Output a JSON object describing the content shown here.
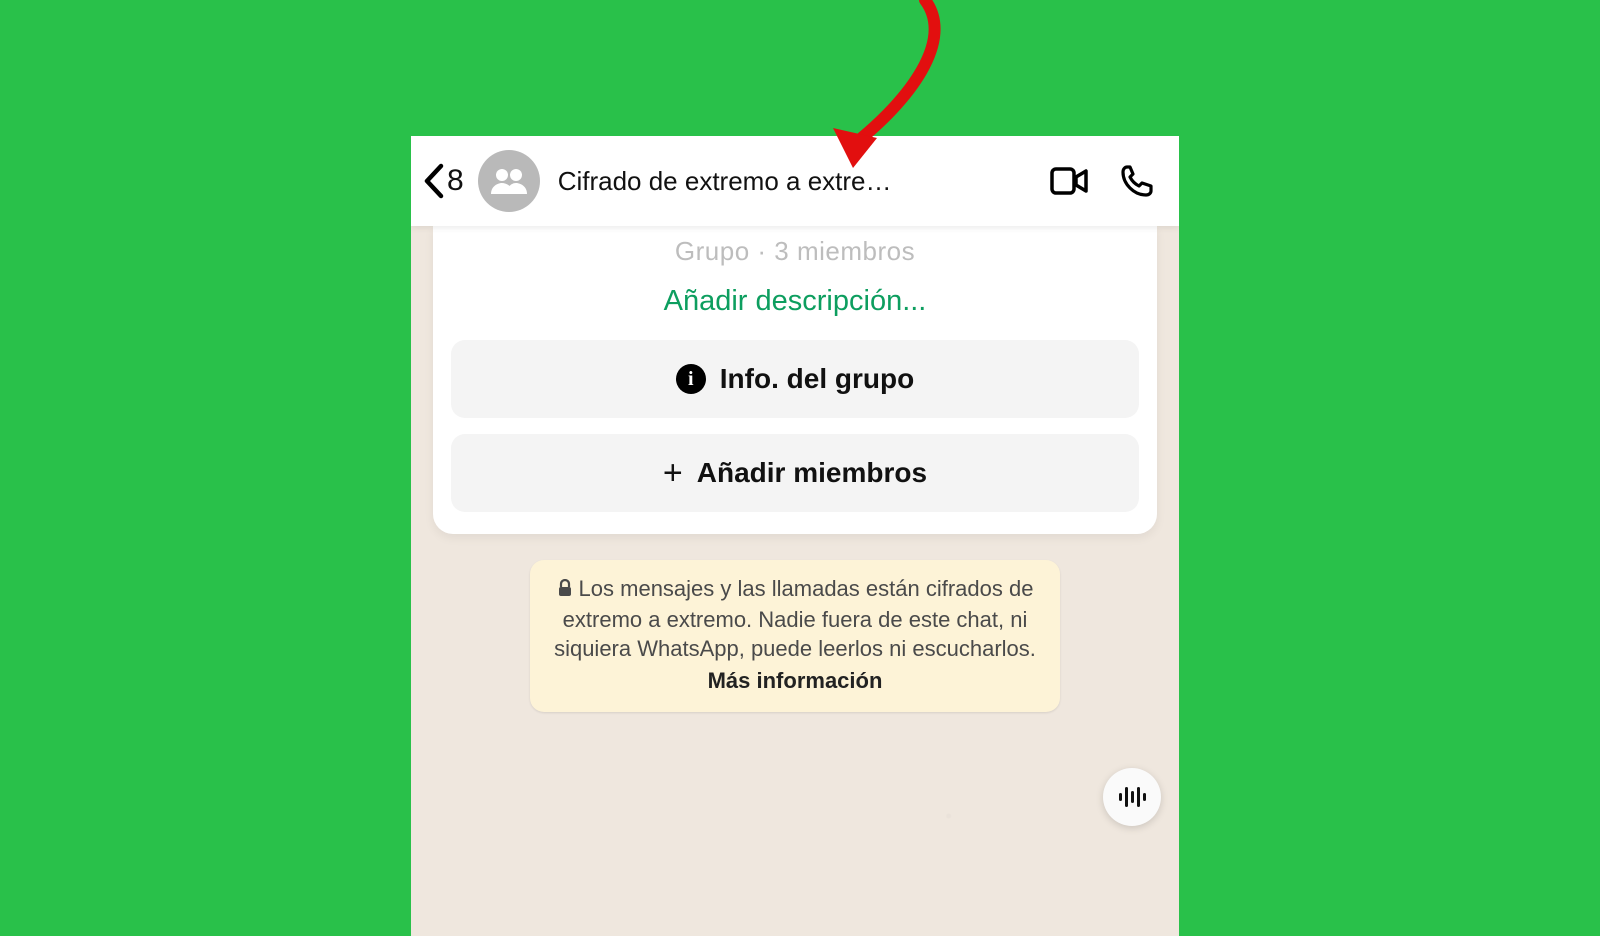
{
  "header": {
    "back_count": "8",
    "title": "Cifrado de extremo a extre…"
  },
  "info_card": {
    "group_meta": "Grupo · 3 miembros",
    "add_description": "Añadir descripción...",
    "group_info_label": "Info. del grupo",
    "add_members_label": "Añadir miembros"
  },
  "encryption_notice": {
    "text": "Los mensajes y las llamadas están cifrados de extremo a extremo. Nadie fuera de este chat, ni siquiera WhatsApp, puede leerlos ni escucharlos.",
    "more_label": "Más información"
  }
}
